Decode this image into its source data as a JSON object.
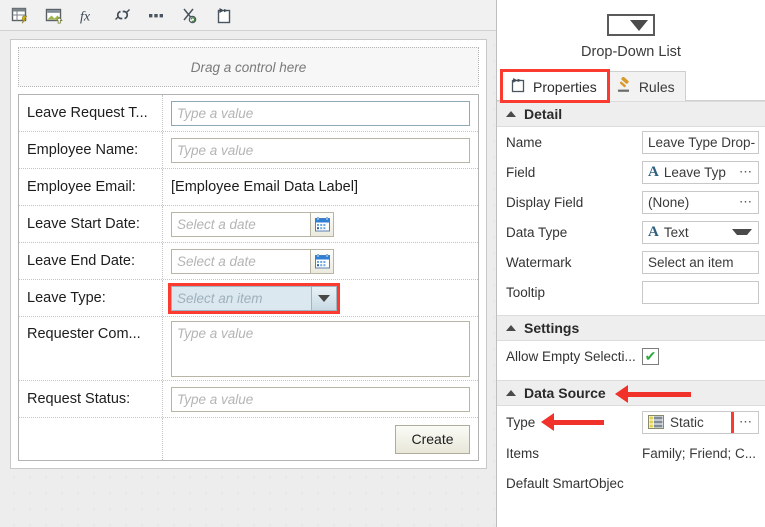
{
  "toolbar": {
    "buttons": [
      {
        "name": "view-data-icon",
        "title": ""
      },
      {
        "name": "image-upload-icon",
        "title": ""
      },
      {
        "name": "function-fx-icon",
        "title": ""
      },
      {
        "name": "broken-link-icon",
        "title": ""
      },
      {
        "name": "ellipsis-icon",
        "title": ""
      },
      {
        "name": "cut-refresh-icon",
        "title": ""
      },
      {
        "name": "paste-icon",
        "title": ""
      }
    ]
  },
  "canvas": {
    "dropzone_text": "Drag a control here",
    "rows": [
      {
        "label": "Leave Request T...",
        "control": "textbox",
        "placeholder": "Type a value",
        "focused": true
      },
      {
        "label": "Employee Name:",
        "control": "textbox",
        "placeholder": "Type a value",
        "focused": false
      },
      {
        "label": "Employee Email:",
        "control": "datalabel",
        "value": "[Employee Email Data Label]"
      },
      {
        "label": "Leave Start Date:",
        "control": "datepicker",
        "placeholder": "Select a date"
      },
      {
        "label": "Leave End Date:",
        "control": "datepicker",
        "placeholder": "Select a date"
      },
      {
        "label": "Leave Type:",
        "control": "dropdown",
        "placeholder": "Select an item",
        "highlighted": true
      },
      {
        "label": "Requester Com...",
        "control": "textarea",
        "placeholder": "Type a value"
      },
      {
        "label": "Request Status:",
        "control": "textbox",
        "placeholder": "Type a value",
        "focused": false
      },
      {
        "label": "",
        "control": "button",
        "button_label": "Create"
      }
    ]
  },
  "properties": {
    "control_name": "Drop-Down List",
    "control_icon": "drop-down-list-icon",
    "tabs": [
      {
        "label": "Properties",
        "icon": "properties-icon",
        "active": true,
        "highlighted": true
      },
      {
        "label": "Rules",
        "icon": "gavel-icon",
        "active": false,
        "highlighted": false
      }
    ],
    "sections": [
      {
        "title": "Detail",
        "rows": [
          {
            "name": "Name",
            "value": "Leave Type Drop-",
            "kind": "input"
          },
          {
            "name": "Field",
            "value": "Leave Typ",
            "kind": "input-glyph-ellipsis",
            "glyph": "A"
          },
          {
            "name": "Display Field",
            "value": "(None)",
            "kind": "input-ellipsis"
          },
          {
            "name": "Data Type",
            "value": "Text",
            "kind": "input-glyph-chevron",
            "glyph": "A"
          },
          {
            "name": "Watermark",
            "value": "Select an item",
            "kind": "input"
          },
          {
            "name": "Tooltip",
            "value": "",
            "kind": "input"
          }
        ]
      },
      {
        "title": "Settings",
        "rows": [
          {
            "name": "Allow Empty Selecti...",
            "value": "✔",
            "kind": "checkbox",
            "checked": true
          }
        ]
      },
      {
        "title": "Data Source",
        "annotated": true,
        "rows": [
          {
            "name": "Type",
            "value": "Static",
            "kind": "input-icon-ellipsis",
            "icon": "static-list-icon",
            "annotated": true,
            "ellipsis_highlighted": true
          },
          {
            "name": "Items",
            "value": "Family; Friend; C...",
            "kind": "text"
          },
          {
            "name": "Default SmartObjec",
            "value": "",
            "kind": "text-cut"
          }
        ]
      }
    ]
  },
  "colors": {
    "annotation_red": "#fb3b30",
    "arrow_red": "#f0322a",
    "section_bg": "#eeeeee",
    "canvas_bg": "#ededed",
    "dropdown_fill": "#dbe8f0"
  }
}
